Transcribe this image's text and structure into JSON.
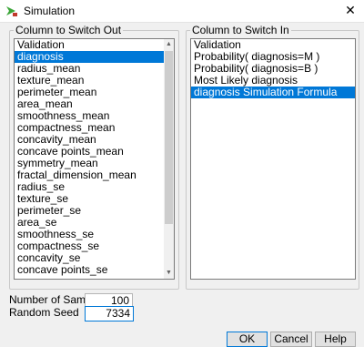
{
  "window": {
    "title": "Simulation",
    "close_glyph": "✕"
  },
  "switch_out": {
    "legend": "Column to Switch Out",
    "items": [
      {
        "label": "Validation",
        "selected": false
      },
      {
        "label": "diagnosis",
        "selected": true
      },
      {
        "label": "radius_mean",
        "selected": false
      },
      {
        "label": "texture_mean",
        "selected": false
      },
      {
        "label": "perimeter_mean",
        "selected": false
      },
      {
        "label": "area_mean",
        "selected": false
      },
      {
        "label": "smoothness_mean",
        "selected": false
      },
      {
        "label": "compactness_mean",
        "selected": false
      },
      {
        "label": "concavity_mean",
        "selected": false
      },
      {
        "label": "concave points_mean",
        "selected": false
      },
      {
        "label": "symmetry_mean",
        "selected": false
      },
      {
        "label": "fractal_dimension_mean",
        "selected": false
      },
      {
        "label": "radius_se",
        "selected": false
      },
      {
        "label": "texture_se",
        "selected": false
      },
      {
        "label": "perimeter_se",
        "selected": false
      },
      {
        "label": "area_se",
        "selected": false
      },
      {
        "label": "smoothness_se",
        "selected": false
      },
      {
        "label": "compactness_se",
        "selected": false
      },
      {
        "label": "concavity_se",
        "selected": false
      },
      {
        "label": "concave points_se",
        "selected": false
      }
    ]
  },
  "switch_in": {
    "legend": "Column to Switch In",
    "items": [
      {
        "label": "Validation",
        "selected": false
      },
      {
        "label": "Probability( diagnosis=M )",
        "selected": false
      },
      {
        "label": "Probability( diagnosis=B )",
        "selected": false
      },
      {
        "label": "Most Likely diagnosis",
        "selected": false
      },
      {
        "label": "diagnosis Simulation Formula",
        "selected": true
      }
    ]
  },
  "options": {
    "samples_label": "Number of Samples",
    "samples_value": "100",
    "seed_label": "Random Seed",
    "seed_value": "7334"
  },
  "buttons": {
    "ok": "OK",
    "cancel": "Cancel",
    "help": "Help"
  },
  "colors": {
    "selection": "#0078d7",
    "app_icon": "#3aa537"
  }
}
